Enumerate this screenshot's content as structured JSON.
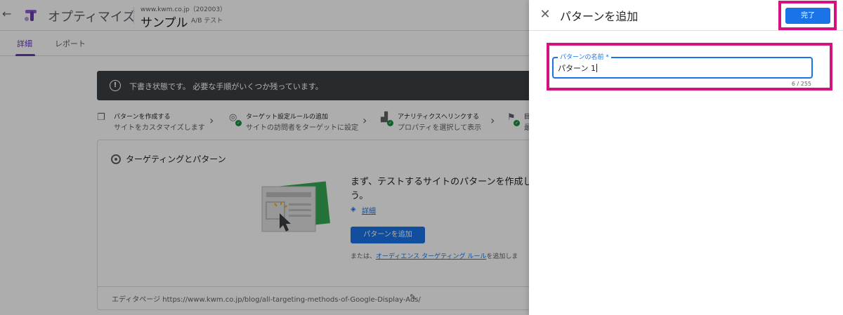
{
  "app": {
    "back_icon": "arrow-left-icon",
    "title": "オプティマイズ",
    "account": "www.kwm.co.jp（202003）",
    "container": "サンプル",
    "experience_type": "A/B テスト"
  },
  "tabs": [
    {
      "label": "詳細",
      "active": true
    },
    {
      "label": "レポート",
      "active": false
    }
  ],
  "draft_banner": {
    "text": "下書き状態です。 必要な手順がいくつか残っています。"
  },
  "steps": [
    {
      "title": "パターンを作成する",
      "subtitle": "サイトをカスタマイズします",
      "done": false
    },
    {
      "title": "ターゲット設定ルールの追加",
      "subtitle": "サイトの訪問者をターゲットに設定",
      "done": true
    },
    {
      "title": "アナリティクスへリンクする",
      "subtitle": "プロパティを選択して表示",
      "done": true
    },
    {
      "title": "目",
      "subtitle": "最",
      "done": true
    }
  ],
  "targeting_card": {
    "title": "ターゲティングとパターン",
    "description": "まず、テストするサイトのパターンを作成しう。",
    "detail_link": "詳細",
    "add_button": "パターンを追加",
    "alt_prefix": "または、",
    "alt_link": "オーディエンス ターゲティング ルール",
    "alt_suffix": "を追加しま",
    "editor_page": "エディタページ https://www.kwm.co.jp/blog/all-targeting-methods-of-Google-Display-Ads/"
  },
  "panel": {
    "title": "パターンを追加",
    "close_icon": "close-icon",
    "done_button": "完了",
    "field": {
      "label": "パターンの名前 *",
      "value": "パターン 1",
      "counter": "6 / 255"
    }
  },
  "colors": {
    "accent": "#1a73e8",
    "highlight": "#d5117f",
    "tab_active": "#673ab7",
    "banner": "#3c4043"
  }
}
